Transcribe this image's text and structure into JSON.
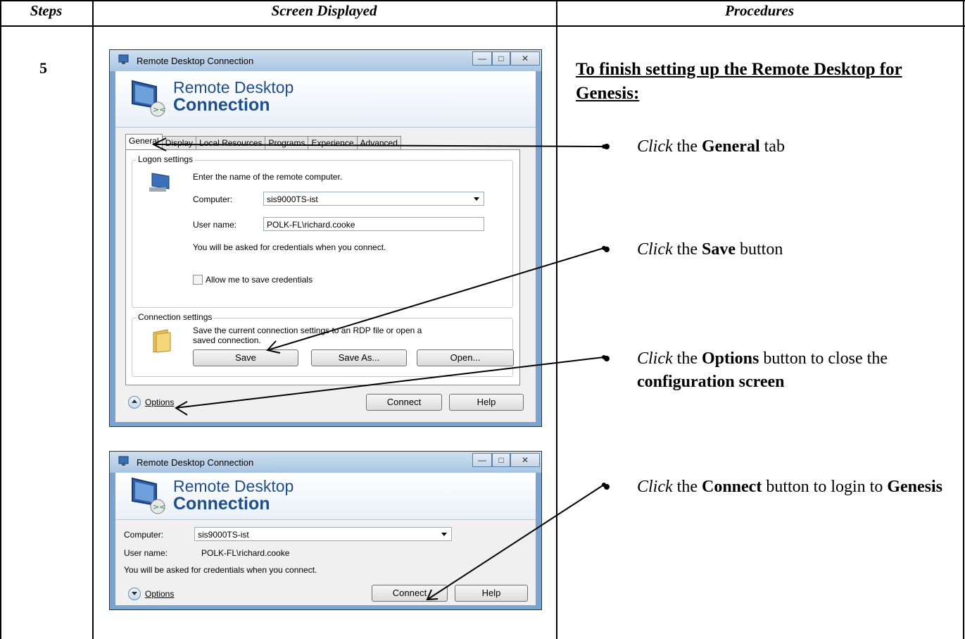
{
  "table": {
    "headers": [
      "Steps",
      "Screen Displayed",
      "Procedures"
    ],
    "step_number": "5"
  },
  "procedures": {
    "title": "To finish setting up the Remote Desktop for Genesis:",
    "items": [
      {
        "verb": "Click",
        "pre": " the ",
        "bold": "General",
        "post": " tab",
        "bold2": ""
      },
      {
        "verb": "Click",
        "pre": " the ",
        "bold": "Save",
        "post": " button",
        "bold2": ""
      },
      {
        "verb": "Click",
        "pre": " the ",
        "bold": "Options",
        "post": " button to close the ",
        "bold2": "configuration screen"
      },
      {
        "verb": "Click",
        "pre": " the ",
        "bold": "Connect",
        "post": " button to login to ",
        "bold2": "Genesis"
      }
    ]
  },
  "dialog_expanded": {
    "window_title": "Remote Desktop Connection",
    "banner_line1": "Remote Desktop",
    "banner_line2": "Connection",
    "tabs": [
      "General",
      "Display",
      "Local Resources",
      "Programs",
      "Experience",
      "Advanced"
    ],
    "logon_group": "Logon settings",
    "logon_instruction": "Enter the name of the remote computer.",
    "computer_label": "Computer:",
    "computer_value": "sis9000TS-ist",
    "username_label": "User name:",
    "username_value": "POLK-FL\\richard.cooke",
    "credentials_note": "You will be asked for credentials when you connect.",
    "allow_save_label": "Allow me to save credentials",
    "connection_group": "Connection settings",
    "connection_text_1": "Save the current connection settings to an RDP file or open a",
    "connection_text_2": "saved connection.",
    "save_label": "Save",
    "save_as_label": "Save As...",
    "open_label": "Open...",
    "options_label": "Options",
    "connect_label": "Connect",
    "help_label": "Help"
  },
  "dialog_collapsed": {
    "window_title": "Remote Desktop Connection",
    "banner_line1": "Remote Desktop",
    "banner_line2": "Connection",
    "computer_label": "Computer:",
    "computer_value": "sis9000TS-ist",
    "username_label": "User name:",
    "username_value": "POLK-FL\\richard.cooke",
    "credentials_note": "You will be asked for credentials when you connect.",
    "options_label": "Options",
    "connect_label": "Connect",
    "help_label": "Help"
  }
}
